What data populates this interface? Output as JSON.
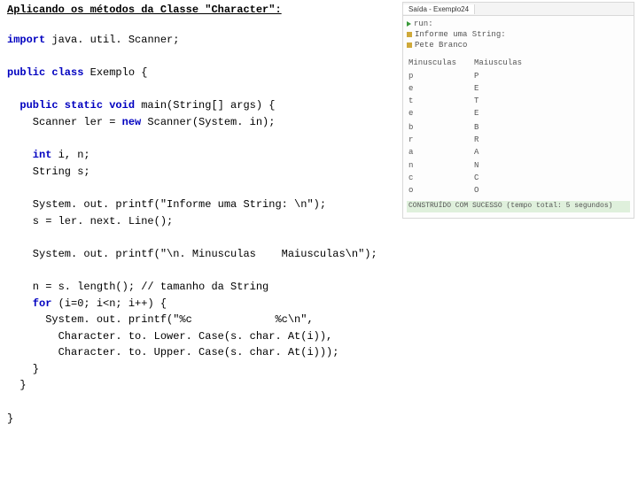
{
  "title": "Aplicando os métodos da Classe \"Character\":",
  "code": {
    "l1a": "import",
    "l1b": " java. util. Scanner;",
    "l2a": "public class",
    "l2b": " Exemplo {",
    "l3a": "  public static void",
    "l3b": " main(String[] args) {",
    "l4": "    Scanner ler = ",
    "l4a": "new",
    "l4b": " Scanner(System. in);",
    "l5a": "    int",
    "l5b": " i, n;",
    "l6": "    String s;",
    "l7": "    System. out. printf(\"Informe uma String: \\n\");",
    "l8": "    s = ler. next. Line();",
    "l9": "    System. out. printf(\"\\n. Minusculas    Maiusculas\\n\");",
    "l10": "    n = s. length(); // tamanho da String",
    "l11a": "    for",
    "l11b": " (i=0; i<n; i++) {",
    "l12": "      System. out. printf(\"%c             %c\\n\",",
    "l13": "        Character. to. Lower. Case(s. char. At(i)),",
    "l14": "        Character. to. Upper. Case(s. char. At(i)));",
    "l15": "    }",
    "l16": "  }",
    "l17": "}"
  },
  "output": {
    "tab": "Saída - Exemplo24",
    "run": "run:",
    "prompt": "Informe uma String:",
    "input": "Pete Branco",
    "col1": "Minusculas",
    "col2": "Maiusculas",
    "rows": [
      [
        "p",
        "P"
      ],
      [
        "e",
        "E"
      ],
      [
        "t",
        "T"
      ],
      [
        "e",
        "E"
      ],
      [
        " ",
        " "
      ],
      [
        "b",
        "B"
      ],
      [
        "r",
        "R"
      ],
      [
        "a",
        "A"
      ],
      [
        "n",
        "N"
      ],
      [
        "c",
        "C"
      ],
      [
        "o",
        "O"
      ]
    ],
    "success": "CONSTRUÍDO COM SUCESSO (tempo total: 5 segundos)"
  }
}
